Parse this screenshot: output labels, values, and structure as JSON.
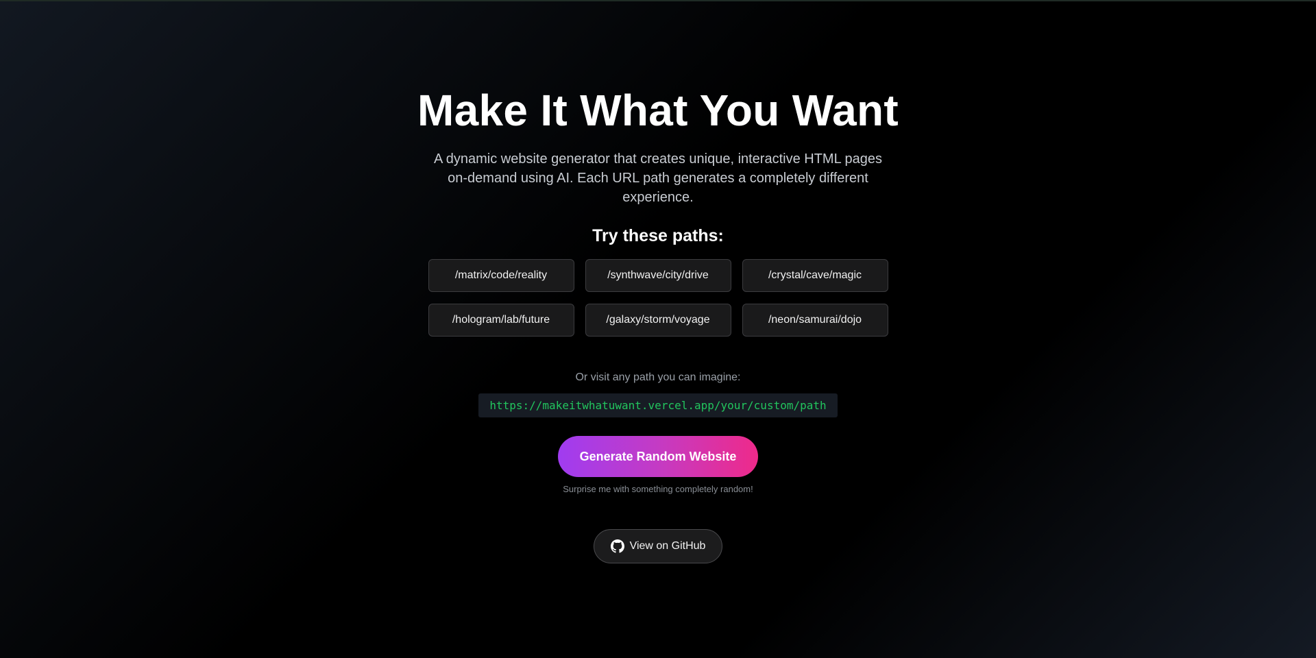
{
  "hero": {
    "title": "Make It What You Want",
    "description": "A dynamic website generator that creates unique, interactive HTML pages on-demand using AI. Each URL path generates a completely different experience."
  },
  "paths": {
    "heading": "Try these paths:",
    "items": [
      "/matrix/code/reality",
      "/synthwave/city/drive",
      "/crystal/cave/magic",
      "/hologram/lab/future",
      "/galaxy/storm/voyage",
      "/neon/samurai/dojo"
    ]
  },
  "custom": {
    "label": "Or visit any path you can imagine:",
    "url": "https://makeitwhatuwant.vercel.app/your/custom/path"
  },
  "generate": {
    "button_label": "Generate Random Website",
    "caption": "Surprise me with something completely random!"
  },
  "github": {
    "label": "View on GitHub",
    "icon": "github-icon"
  },
  "colors": {
    "code_text": "#22c55e",
    "gradient_start": "#a03cf0",
    "gradient_end": "#ee2a8a"
  }
}
